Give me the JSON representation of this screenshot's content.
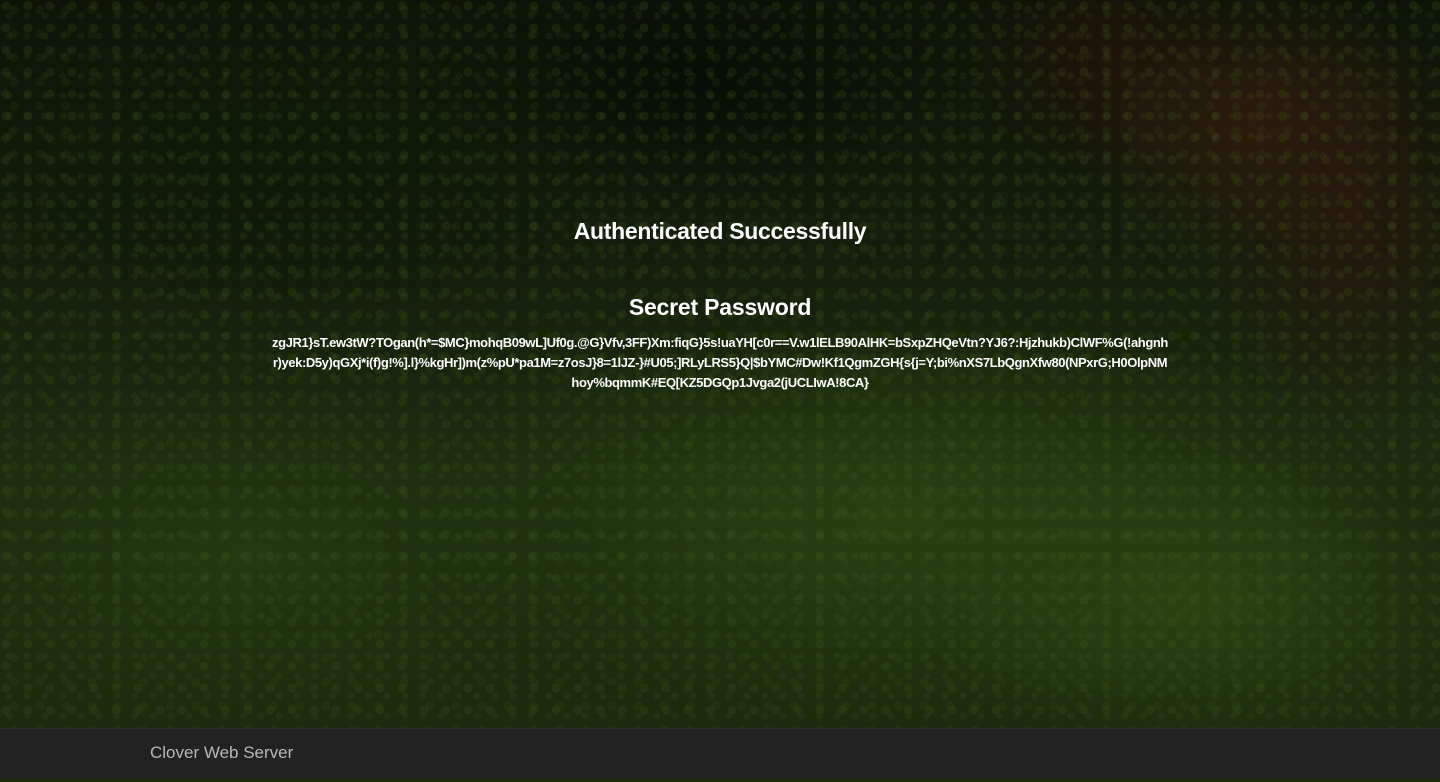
{
  "main": {
    "auth_status": "Authenticated Successfully",
    "secret_title": "Secret Password",
    "secret_value": "zgJR1}sT.ew3tW?TOgan(h*=$MC}mohqB09wL]Uf0g.@G}Vfv,3FF)Xm:fiqG}5s!uaYH[c0r==V.w1lELB90AlHK=bSxpZHQeVtn?YJ6?:Hjzhukb)ClWF%G(!ahgnhr)yek:D5y)qGXj*i(f)g!%].l}%kgHr])m(z%pU*pa1M=z7osJ}8=1lJZ-}#U05;]RLyLRS5}Q|$bYMC#Dw!Kf1QgmZGH{s{j=Y;bi%nXS7LbQgnXfw80(NPxrG;H0OlpNMhoy%bqmmK#EQ[KZ5DGQp1Jvga2(jUCLIwA!8CA}"
  },
  "footer": {
    "brand": "Clover Web Server"
  },
  "colors": {
    "text": "#ffffff",
    "footer_bg": "#222222",
    "footer_text": "#b8b8b8"
  }
}
